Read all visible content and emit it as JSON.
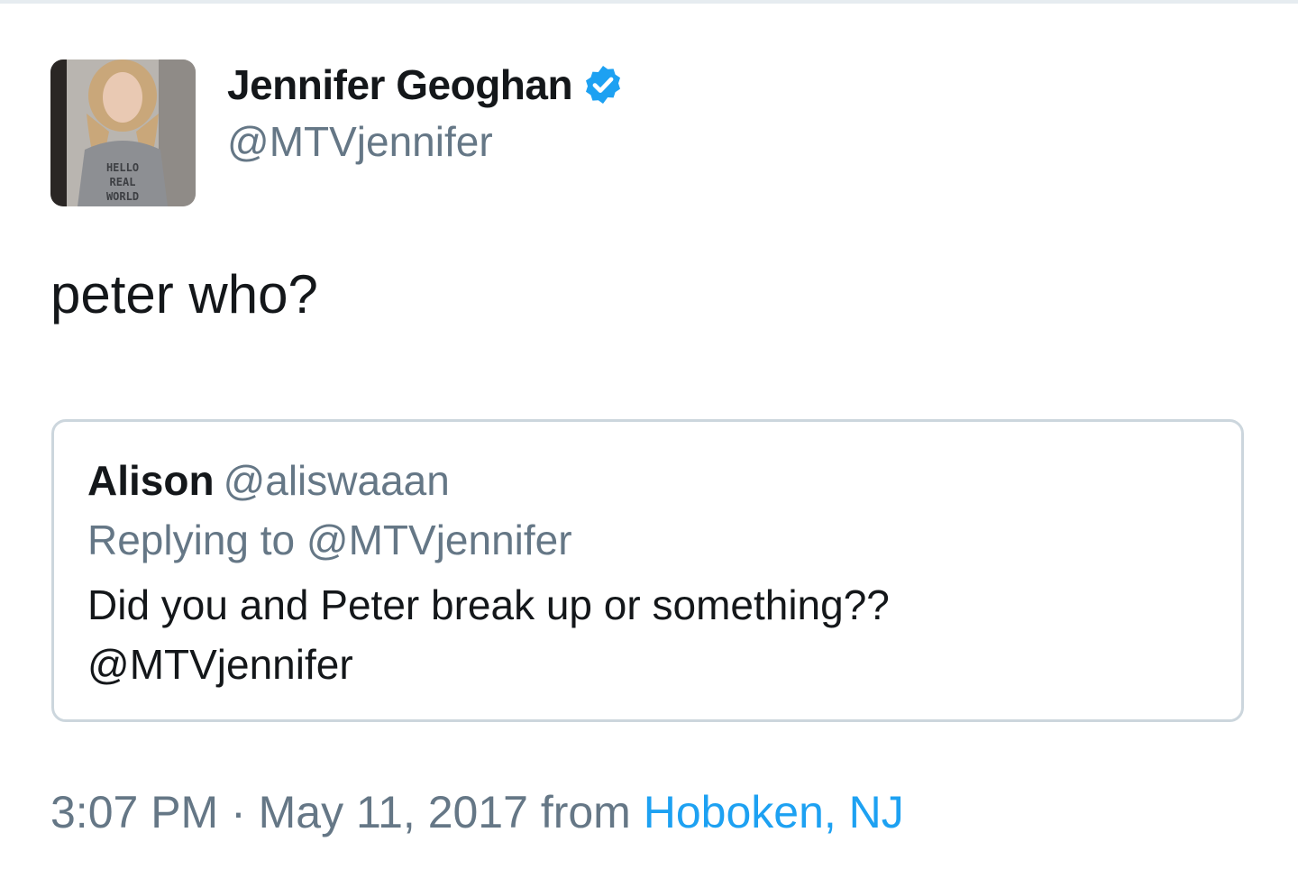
{
  "author": {
    "display_name": "Jennifer Geoghan",
    "handle": "@MTVjennifer",
    "verified": true,
    "avatar_shirt_text": [
      "HELLO",
      "REAL",
      "WORLD"
    ]
  },
  "tweet": {
    "text": "peter who?"
  },
  "quoted_tweet": {
    "name": "Alison",
    "handle": "@aliswaaan",
    "replying_to": "Replying to @MTVjennifer",
    "text_line1": "Did you and Peter break up or something??",
    "text_line2": "@MTVjennifer"
  },
  "meta": {
    "time": "3:07 PM",
    "separator": " · ",
    "date": "May 11, 2017",
    "from_label": " from ",
    "place": "Hoboken, NJ"
  },
  "colors": {
    "text_primary": "#14171a",
    "text_secondary": "#657786",
    "link_blue": "#1da1f2",
    "border": "#ccd6dd"
  }
}
